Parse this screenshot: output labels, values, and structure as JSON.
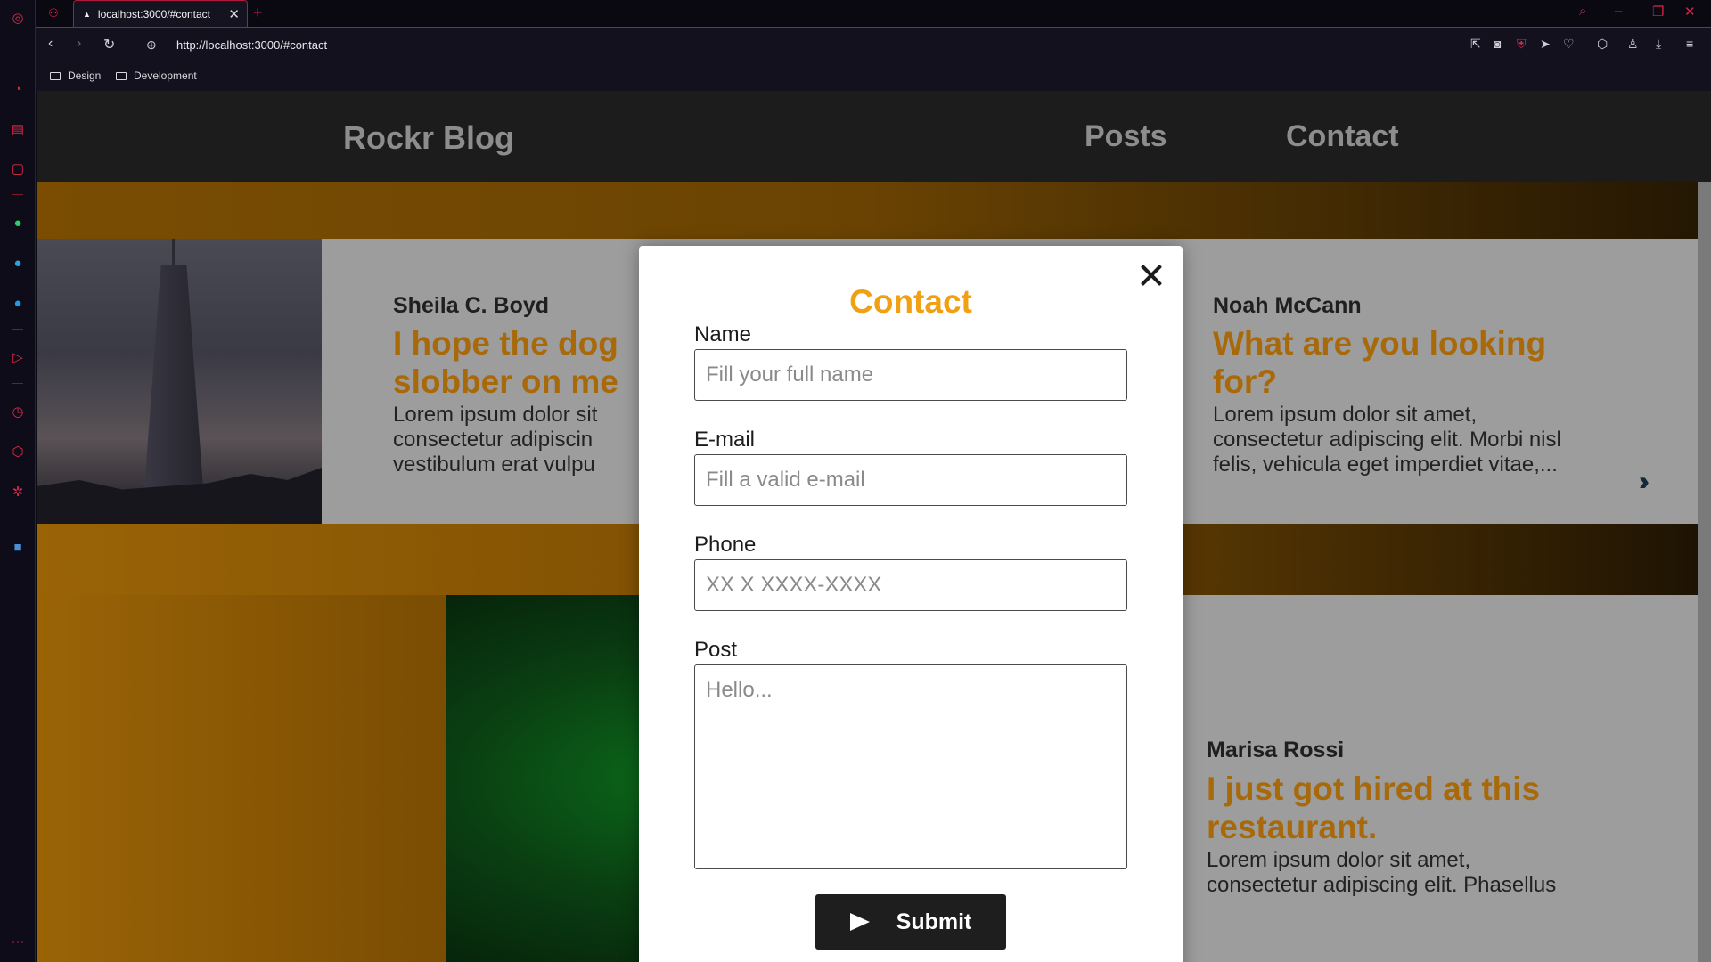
{
  "browser": {
    "tab_title": "localhost:3000/#contact",
    "url": "http://localhost:3000/#contact",
    "bookmarks": [
      "Design",
      "Development"
    ],
    "accent": "#e0294a"
  },
  "site": {
    "logo": "Rockr Blog",
    "nav": [
      "Posts",
      "Contact"
    ]
  },
  "posts": [
    {
      "author": "Sheila C. Boyd",
      "title_line1": "I hope the dog",
      "title_line2": "slobber on me",
      "text_line1": "Lorem ipsum dolor sit",
      "text_line2": "consectetur adipiscin",
      "text_line3": "vestibulum erat vulpu"
    },
    {
      "author": "Noah McCann",
      "title_line1": "What are you looking",
      "title_line2": "for?",
      "text_line1": "Lorem ipsum dolor sit amet,",
      "text_line2": "consectetur adipiscing elit. Morbi nisl",
      "text_line3": "felis, vehicula eget imperdiet vitae,...",
      "more_icon": "double-chevron-right"
    },
    {
      "author": "Marisa Rossi",
      "title_line1": "I just got hired at this",
      "title_line2": "restaurant.",
      "text_line1": "Lorem ipsum dolor sit amet,",
      "text_line2": "consectetur adipiscing elit. Phasellus"
    }
  ],
  "modal": {
    "title": "Contact",
    "title_color": "#f0a012",
    "fields": [
      {
        "label": "Name",
        "placeholder": "Fill your full name"
      },
      {
        "label": "E-mail",
        "placeholder": "Fill a valid e-mail"
      },
      {
        "label": "Phone",
        "placeholder": "XX X XXXX-XXXX"
      },
      {
        "label": "Post",
        "placeholder": "Hello..."
      }
    ],
    "submit_label": "Submit"
  }
}
